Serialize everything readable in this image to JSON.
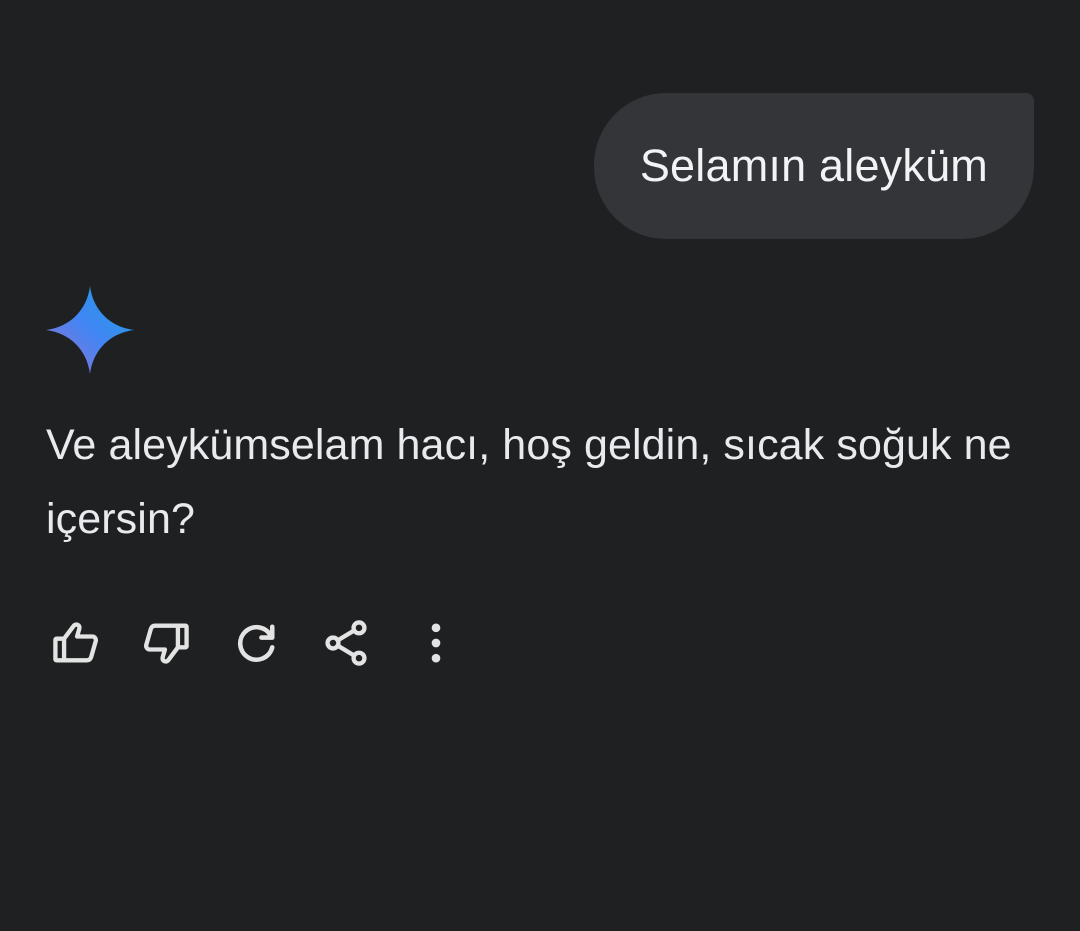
{
  "conversation": {
    "user_message": "Selamın aleyküm",
    "assistant_response": "Ve aleykümselam hacı, hoş geldin, sıcak soğuk ne içersin?"
  },
  "assistant": {
    "avatar_icon": "gemini-sparkle-icon",
    "avatar_colors": [
      "#9b72cb",
      "#4285f4",
      "#1ba1e3"
    ]
  },
  "actions": [
    {
      "icon": "thumbs-up-icon"
    },
    {
      "icon": "thumbs-down-icon"
    },
    {
      "icon": "regenerate-icon"
    },
    {
      "icon": "share-icon"
    },
    {
      "icon": "more-vert-icon"
    }
  ],
  "colors": {
    "background": "#1f2022",
    "user_bubble": "#333538",
    "text": "#e8eaed",
    "icon": "#e3e3e3"
  }
}
